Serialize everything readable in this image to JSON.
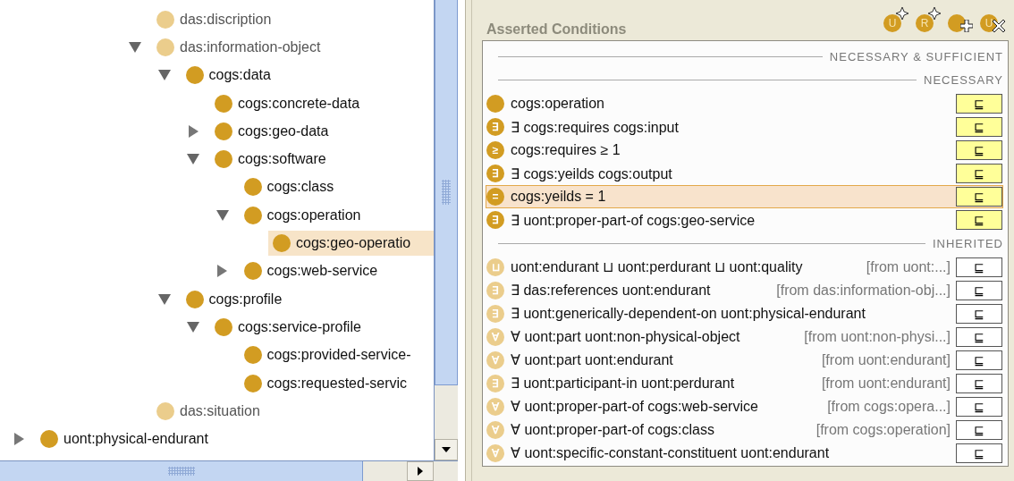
{
  "class_tree": {
    "items": [
      {
        "children": [
          {
            "children": [
              {
                "children": [
                  {
                    "children": [
                      {
                        "label": "das:discription",
                        "imported": true,
                        "kind": "leaf",
                        "selected": false
                      },
                      {
                        "label": "das:information-object",
                        "imported": true,
                        "kind": "branch",
                        "expanded": true,
                        "selected": false,
                        "children": [
                          {
                            "label": "cogs:data",
                            "imported": false,
                            "kind": "branch",
                            "expanded": true,
                            "selected": false,
                            "children": [
                              {
                                "label": "cogs:concrete-data",
                                "imported": false,
                                "kind": "leaf",
                                "selected": false
                              },
                              {
                                "label": "cogs:geo-data",
                                "imported": false,
                                "kind": "branch",
                                "expanded": false,
                                "selected": false
                              },
                              {
                                "label": "cogs:software",
                                "imported": false,
                                "kind": "branch",
                                "expanded": true,
                                "selected": false,
                                "children": [
                                  {
                                    "label": "cogs:class",
                                    "imported": false,
                                    "kind": "leaf",
                                    "selected": false
                                  },
                                  {
                                    "label": "cogs:operation",
                                    "imported": false,
                                    "kind": "branch",
                                    "expanded": true,
                                    "selected": false,
                                    "children": [
                                      {
                                        "label": "cogs:geo-operatio",
                                        "imported": false,
                                        "kind": "leaf",
                                        "selected": true
                                      }
                                    ]
                                  },
                                  {
                                    "label": "cogs:web-service",
                                    "imported": false,
                                    "kind": "branch",
                                    "expanded": false,
                                    "selected": false
                                  }
                                ]
                              }
                            ]
                          },
                          {
                            "label": "cogs:profile",
                            "imported": false,
                            "kind": "branch",
                            "expanded": true,
                            "selected": false,
                            "children": [
                              {
                                "label": "cogs:service-profile",
                                "imported": false,
                                "kind": "branch",
                                "expanded": true,
                                "selected": false,
                                "children": [
                                  {
                                    "label": "cogs:provided-service-",
                                    "imported": false,
                                    "kind": "leaf",
                                    "selected": false
                                  },
                                  {
                                    "label": "cogs:requested-servic",
                                    "imported": false,
                                    "kind": "leaf",
                                    "selected": false
                                  }
                                ]
                              }
                            ]
                          }
                        ]
                      },
                      {
                        "label": "das:situation",
                        "imported": true,
                        "kind": "leaf",
                        "selected": false
                      }
                    ]
                  }
                ]
              }
            ]
          }
        ]
      },
      {
        "label": "uont:physical-endurant",
        "imported": false,
        "kind": "branch",
        "expanded": false,
        "selected": false
      }
    ]
  },
  "conditions": {
    "title": "Asserted Conditions",
    "toolbar": [
      {
        "kind": "create",
        "letter": "U"
      },
      {
        "kind": "create",
        "letter": "R"
      },
      {
        "kind": "add"
      },
      {
        "kind": "delete",
        "letter": "U"
      }
    ],
    "sections": [
      {
        "label": "NECESSARY & SUFFICIENT"
      },
      {
        "label": "NECESSARY",
        "rows": [
          {
            "text": "cogs:operation",
            "relation": "⊑",
            "inherited": false,
            "selected": false
          },
          {
            "symbol": "∃",
            "text": "∃ cogs:requires cogs:input",
            "relation": "⊑",
            "inherited": false,
            "selected": false
          },
          {
            "symbol": "≥",
            "text": "cogs:requires ≥ 1",
            "relation": "⊑",
            "inherited": false,
            "selected": false
          },
          {
            "symbol": "∃",
            "text": "∃ cogs:yeilds cogs:output",
            "relation": "⊑",
            "inherited": false,
            "selected": false
          },
          {
            "symbol": "=",
            "text": "cogs:yeilds = 1",
            "relation": "⊑",
            "inherited": false,
            "selected": true
          },
          {
            "symbol": "∃",
            "text": "∃ uont:proper-part-of cogs:geo-service",
            "relation": "⊑",
            "inherited": false,
            "selected": false
          }
        ]
      },
      {
        "label": "INHERITED",
        "rows": [
          {
            "symbol": "⊔",
            "text": "uont:endurant ⊔ uont:perdurant ⊔ uont:quality",
            "source": "[from uont:...]",
            "relation": "⊑",
            "inherited": true,
            "selected": false
          },
          {
            "symbol": "∃",
            "text": "∃ das:references uont:endurant",
            "source": "[from das:information-obj...]",
            "relation": "⊑",
            "inherited": true,
            "selected": false
          },
          {
            "symbol": "∃",
            "text": "∃ uont:generically-dependent-on uont:physical-endurant",
            "relation": "⊑",
            "inherited": true,
            "selected": false
          },
          {
            "symbol": "∀",
            "text": "∀ uont:part uont:non-physical-object",
            "source": "[from uont:non-physi...]",
            "relation": "⊑",
            "inherited": true,
            "selected": false
          },
          {
            "symbol": "∀",
            "text": "∀ uont:part uont:endurant",
            "source": "[from uont:endurant]",
            "relation": "⊑",
            "inherited": true,
            "selected": false
          },
          {
            "symbol": "∃",
            "text": "∃ uont:participant-in uont:perdurant",
            "source": "[from uont:endurant]",
            "relation": "⊑",
            "inherited": true,
            "selected": false
          },
          {
            "symbol": "∀",
            "text": "∀ uont:proper-part-of cogs:web-service",
            "source": "[from cogs:opera...]",
            "relation": "⊑",
            "inherited": true,
            "selected": false
          },
          {
            "symbol": "∀",
            "text": "∀ uont:proper-part-of cogs:class",
            "source": "[from cogs:operation]",
            "relation": "⊑",
            "inherited": true,
            "selected": false
          },
          {
            "symbol": "∀",
            "text": "∀ uont:specific-constant-constituent uont:endurant",
            "relation": "⊑",
            "inherited": true,
            "selected": false
          }
        ]
      }
    ]
  }
}
